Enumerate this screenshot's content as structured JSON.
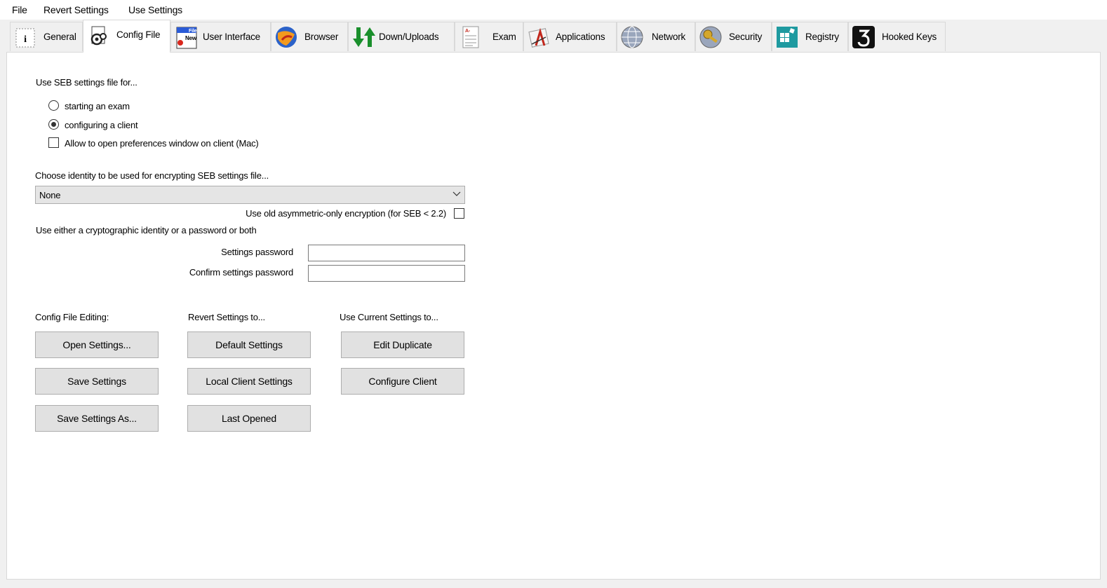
{
  "menu": [
    "File",
    "Revert Settings",
    "Use Settings"
  ],
  "tabs": [
    {
      "label": "General",
      "icon": "info-icon"
    },
    {
      "label": "Config File",
      "icon": "config-file-icon",
      "active": true
    },
    {
      "label": "User Interface",
      "icon": "file-menu-icon"
    },
    {
      "label": "Browser",
      "icon": "browser-globe-icon"
    },
    {
      "label": "Down/Uploads",
      "icon": "down-up-arrows-icon"
    },
    {
      "label": "Exam",
      "icon": "exam-sheet-icon"
    },
    {
      "label": "Applications",
      "icon": "applications-icon"
    },
    {
      "label": "Network",
      "icon": "network-globe-icon"
    },
    {
      "label": "Security",
      "icon": "security-keys-icon"
    },
    {
      "label": "Registry",
      "icon": "registry-icon"
    },
    {
      "label": "Hooked Keys",
      "icon": "hooked-keys-icon"
    }
  ],
  "config": {
    "use_for_label": "Use SEB settings file for...",
    "radio_exam": "starting an exam",
    "radio_client": "configuring a client",
    "selected_mode": "configuring a client",
    "allow_prefs_label": "Allow to open preferences window on client (Mac)",
    "allow_prefs_checked": false,
    "identity_label": "Choose identity to be used for encrypting SEB settings file...",
    "identity_value": "None",
    "old_encryption_label": "Use old asymmetric-only encryption (for SEB < 2.2)",
    "old_encryption_checked": false,
    "either_label": "Use either a cryptographic identity or a password or both",
    "password_label": "Settings password",
    "confirm_label": "Confirm settings password",
    "password_value": "",
    "confirm_value": ""
  },
  "editing": {
    "label": "Config File Editing:",
    "open": "Open Settings...",
    "save": "Save Settings",
    "save_as": "Save Settings As..."
  },
  "revert": {
    "label": "Revert Settings to...",
    "default": "Default Settings",
    "local": "Local Client Settings",
    "last": "Last Opened"
  },
  "use_current": {
    "label": "Use Current Settings to...",
    "duplicate": "Edit Duplicate",
    "configure": "Configure Client"
  },
  "colors": {
    "window_bg": "#f0f0f0",
    "panel_bg": "#ffffff",
    "button_bg": "#e1e1e1",
    "button_border": "#adadad"
  }
}
